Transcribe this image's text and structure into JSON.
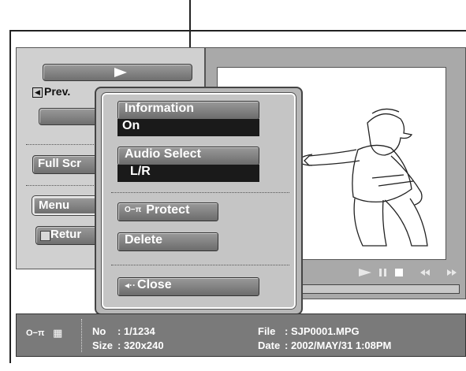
{
  "left_panel": {
    "prev_label": "Prev.",
    "full_screen_label": "Full Scr",
    "menu_label": "Menu",
    "return_label": "Retur"
  },
  "popup": {
    "information": {
      "label": "Information",
      "value": "On"
    },
    "audio_select": {
      "label": "Audio Select",
      "value": "L/R"
    },
    "protect_label": "Protect",
    "delete_label": "Delete",
    "close_label": "Close"
  },
  "status_bar": {
    "no_label": "No",
    "no_value": ": 1/1234",
    "size_label": "Size",
    "size_value": ": 320x240",
    "file_label": "File",
    "file_value": ": SJP0001.MPG",
    "date_label": "Date",
    "date_value": ": 2002/MAY/31 1:08PM"
  },
  "icons": {
    "key": "key-icon",
    "film": "film-icon",
    "play": "play-icon",
    "home": "home-icon",
    "back": "back-arrow-icon"
  }
}
